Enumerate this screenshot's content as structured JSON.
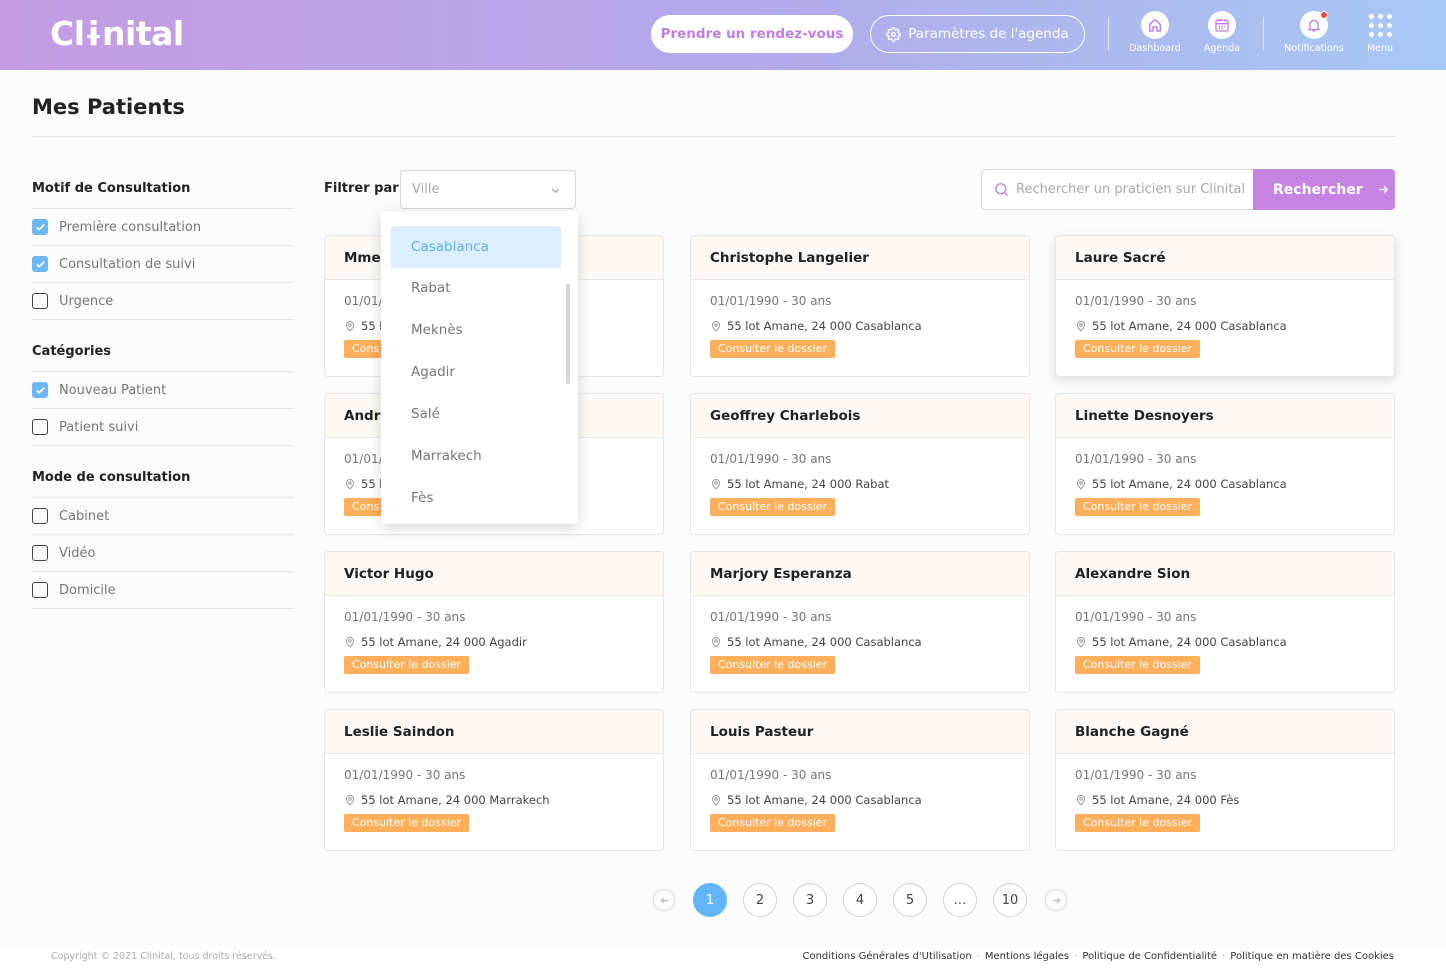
{
  "header": {
    "logo": "Clɨnital",
    "cta_label": "Prendre un rendez-vous",
    "settings_label": "Paramètres de l'agenda",
    "nav": [
      {
        "label": "Dashboard",
        "icon": "home-icon"
      },
      {
        "label": "Agenda",
        "icon": "calendar-icon"
      },
      {
        "label": "Notifications",
        "icon": "bell-icon"
      },
      {
        "label": "Menu",
        "icon": "grid-menu-icon"
      }
    ]
  },
  "page_title": "Mes Patients",
  "sidebar": {
    "sections": [
      {
        "title": "Motif de Consultation",
        "items": [
          {
            "label": "Première consultation",
            "checked": true
          },
          {
            "label": "Consultation de suivi",
            "checked": true
          },
          {
            "label": "Urgence",
            "checked": false
          }
        ]
      },
      {
        "title": "Catégories",
        "items": [
          {
            "label": "Nouveau Patient",
            "checked": true
          },
          {
            "label": "Patient suivi",
            "checked": false
          }
        ]
      },
      {
        "title": "Mode de consultation",
        "items": [
          {
            "label": "Cabinet",
            "checked": false
          },
          {
            "label": "Vidéo",
            "checked": false
          },
          {
            "label": "Domicile",
            "checked": false
          }
        ]
      }
    ]
  },
  "filter": {
    "label": "Filtrer par",
    "select_placeholder": "Ville",
    "options": [
      "Casablanca",
      "Rabat",
      "Meknès",
      "Agadir",
      "Salé",
      "Marrakech",
      "Fès"
    ],
    "highlighted": "Casablanca"
  },
  "search": {
    "placeholder": "Rechercher un praticien sur Clinital",
    "button_label": "Rechercher"
  },
  "patients": [
    {
      "name": "Mme.",
      "dob": "01/01/",
      "address": "55 l",
      "action": "Cons"
    },
    {
      "name": "Christophe Langelier",
      "dob": "01/01/1990 - 30 ans",
      "address": "55 lot Amane, 24 000 Casablanca",
      "action": "Consulter le dossier"
    },
    {
      "name": "Laure Sacré",
      "dob": "01/01/1990 - 30 ans",
      "address": "55 lot Amane, 24 000 Casablanca",
      "action": "Consulter le dossier"
    },
    {
      "name": "Andre",
      "dob": "01/01/",
      "address": "55 l",
      "action": "Cons"
    },
    {
      "name": "Geoffrey Charlebois",
      "dob": "01/01/1990 - 30 ans",
      "address": "55 lot Amane, 24 000 Rabat",
      "action": "Consulter le dossier"
    },
    {
      "name": "Linette Desnoyers",
      "dob": "01/01/1990 - 30 ans",
      "address": "55 lot Amane, 24 000 Casablanca",
      "action": "Consulter le dossier"
    },
    {
      "name": "Victor Hugo",
      "dob": "01/01/1990 - 30 ans",
      "address": "55 lot Amane, 24 000 Agadir",
      "action": "Consulter le dossier"
    },
    {
      "name": "Marjory Esperanza",
      "dob": "01/01/1990 - 30 ans",
      "address": "55 lot Amane, 24 000 Casablanca",
      "action": "Consulter le dossier"
    },
    {
      "name": "Alexandre Sion",
      "dob": "01/01/1990 - 30 ans",
      "address": "55 lot Amane, 24 000 Casablanca",
      "action": "Consulter le dossier"
    },
    {
      "name": "Leslie Saindon",
      "dob": "01/01/1990 - 30 ans",
      "address": "55 lot Amane, 24 000 Marrakech",
      "action": "Consulter le dossier"
    },
    {
      "name": "Louis Pasteur",
      "dob": "01/01/1990 - 30 ans",
      "address": "55 lot Amane, 24 000 Casablanca",
      "action": "Consulter le dossier"
    },
    {
      "name": "Blanche Gagné",
      "dob": "01/01/1990 - 30 ans",
      "address": "55 lot Amane, 24 000 Fès",
      "action": "Consulter le dossier"
    }
  ],
  "pagination": {
    "pages": [
      "1",
      "2",
      "3",
      "4",
      "5",
      "...",
      "10"
    ],
    "current": "1"
  },
  "footer": {
    "copyright": "Copyright © 2021 Clinital, tous droits réservés.",
    "links": [
      "Conditions Générales d'Utilisation",
      "Mentions légales",
      "Politique de Confidentialité",
      "Politique en matière des Cookies"
    ]
  },
  "colors": {
    "accent_purple": "#c884e3",
    "accent_orange": "#ffaf59",
    "accent_blue": "#64b5f6"
  }
}
